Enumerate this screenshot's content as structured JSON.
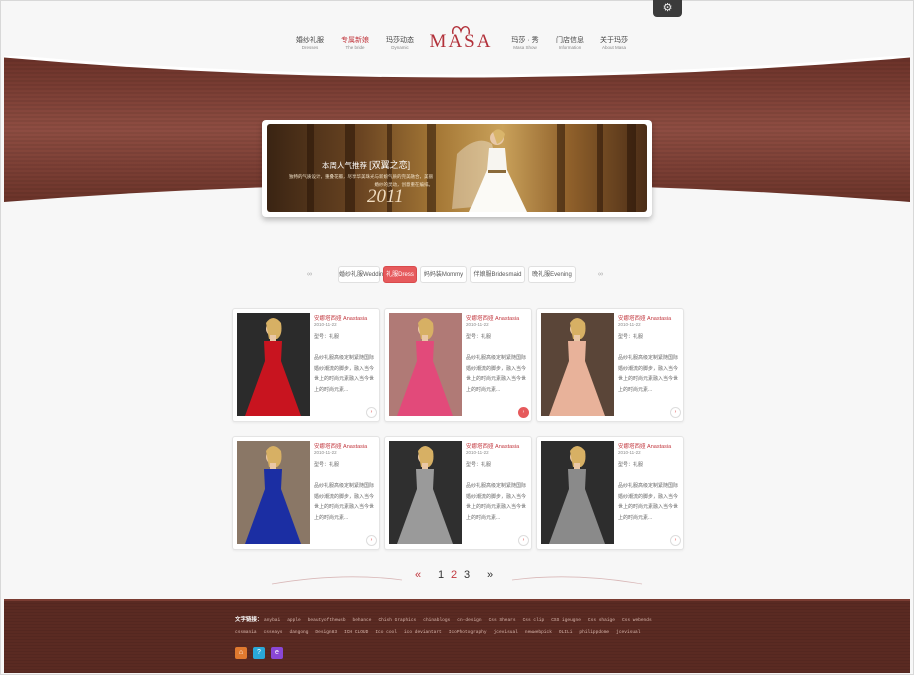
{
  "nav": {
    "left": [
      {
        "cn": "婚纱礼服",
        "en": "Dresses"
      },
      {
        "cn": "专属新娘",
        "en": "The bride"
      },
      {
        "cn": "玛莎动态",
        "en": "Dynamic"
      }
    ],
    "logo": "MASA",
    "right": [
      {
        "cn": "玛莎 · 秀",
        "en": "Masa Show"
      },
      {
        "cn": "门店信息",
        "en": "Information"
      },
      {
        "cn": "关于玛莎",
        "en": "About Masa"
      }
    ]
  },
  "hero": {
    "title_prefix": "本周人气推荐",
    "title_name": "[双翼之恋]",
    "subtitle": "独特的气质设计，重叠花瓣，尽享华美珠光与新娘气质的完美融合，美丽婚纱的灵动，创意重在编排。",
    "year": "2011"
  },
  "tabs": [
    {
      "label": "婚纱礼服Wedding"
    },
    {
      "label": "礼服Dress"
    },
    {
      "label": "妈妈装Mommy"
    },
    {
      "label": "伴娘服Bridesmaid"
    },
    {
      "label": "晚礼服Evening"
    }
  ],
  "products": [
    {
      "name": "安娜塔西娅 Anastasia",
      "date": "2010-11-22",
      "model": "型号：礼服",
      "desc": "品纱礼服高级定制紧随国际婚纱潮流的脚步，融入当今世上的时尚元素融入当今世上的时尚元素...",
      "dress": "#c8141f"
    },
    {
      "name": "安娜塔西娅 Anastasia",
      "date": "2010-11-22",
      "model": "型号：礼服",
      "desc": "品纱礼服高级定制紧随国际婚纱潮流的脚步，融入当今世上的时尚元素融入当今世上的时尚元素...",
      "dress": "#e24a7a"
    },
    {
      "name": "安娜塔西娅 Anastasia",
      "date": "2010-11-22",
      "model": "型号：礼服",
      "desc": "品纱礼服高级定制紧随国际婚纱潮流的脚步，融入当今世上的时尚元素融入当今世上的时尚元素...",
      "dress": "#e8b29a"
    },
    {
      "name": "安娜塔西娅 Anastasia",
      "date": "2010-11-22",
      "model": "型号：礼服",
      "desc": "品纱礼服高级定制紧随国际婚纱潮流的脚步，融入当今世上的时尚元素融入当今世上的时尚元素...",
      "dress": "#1b2ea3"
    },
    {
      "name": "安娜塔西娅 Anastasia",
      "date": "2010-11-22",
      "model": "型号：礼服",
      "desc": "品纱礼服高级定制紧随国际婚纱潮流的脚步，融入当今世上的时尚元素融入当今世上的时尚元素...",
      "dress": "#9a9a9a"
    },
    {
      "name": "安娜塔西娅 Anastasia",
      "date": "2010-11-22",
      "model": "型号：礼服",
      "desc": "品纱礼服高级定制紧随国际婚纱潮流的脚步，融入当今世上的时尚元素融入当今世上的时尚元素...",
      "dress": "#8a8a8a"
    }
  ],
  "pager": {
    "prev": "«",
    "pages": [
      "1",
      "2",
      "3"
    ],
    "next": "»"
  },
  "footer": {
    "label": "文字链接：",
    "links_row1": [
      "anybai",
      "apple",
      "beautyofthewsb",
      "behance",
      "Chish Graphics",
      "chinablogs",
      "cn-design",
      "Css Shears",
      "Css clip",
      "CSS igeugne",
      "Css shaige",
      "Css webends"
    ],
    "links_row2": [
      "cssmania",
      "csseays",
      "dangong",
      "Design83",
      "ICH CLOUD",
      "Ico cool",
      "ico deviantart",
      "IcoPhotography",
      "jcevisual",
      "newwebpick",
      "OLILi",
      "philippdome",
      "jcevisual"
    ]
  },
  "colors": {
    "accent": "#c2383f",
    "band": "#7b3e34",
    "footer": "#5a2a22"
  },
  "icons": [
    "gear-icon",
    "home-icon",
    "qq-icon",
    "browser-icon"
  ]
}
